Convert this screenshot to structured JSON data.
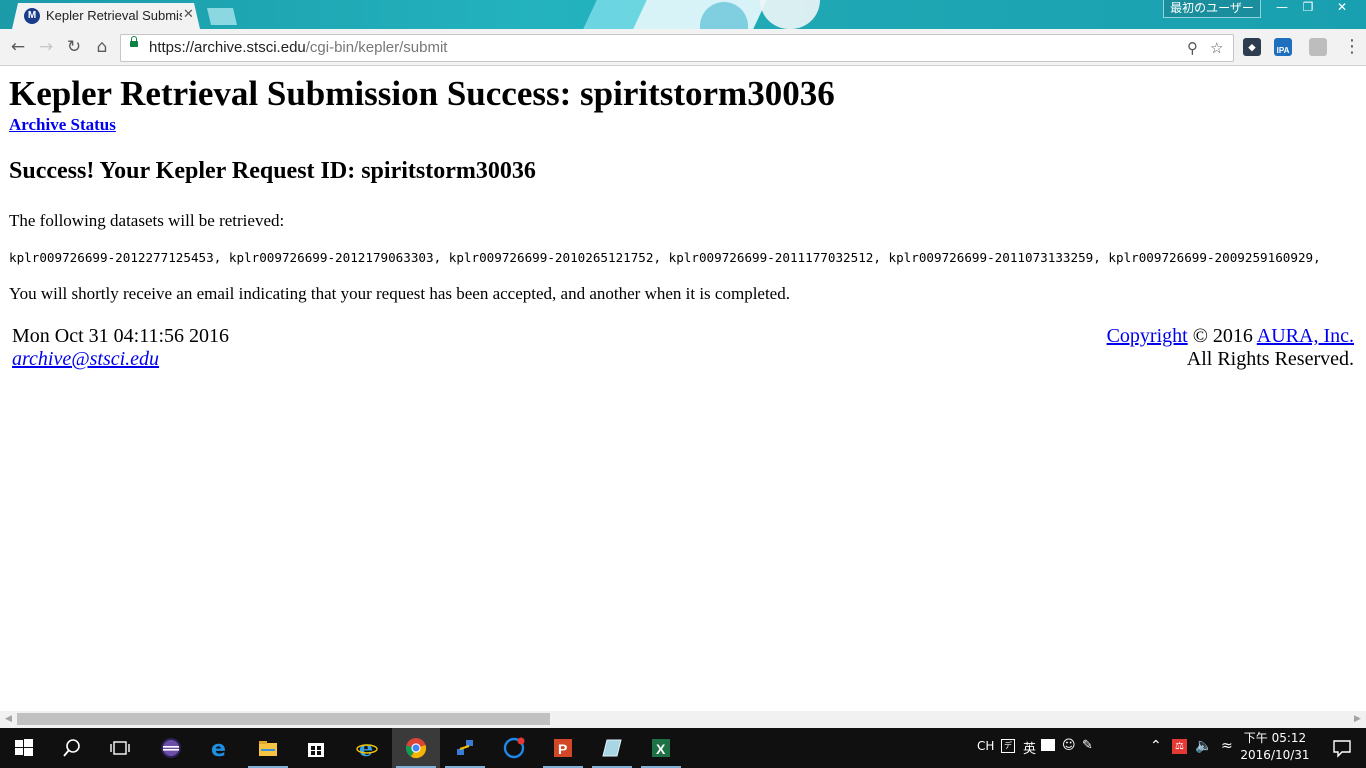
{
  "browser": {
    "tab_title": "Kepler Retrieval Submis",
    "favicon_letter": "M",
    "tab_close": "✕",
    "profile_name": "最初のユーザー",
    "url_scheme": "https://",
    "url_host": "archive.stsci.edu",
    "url_path": "/cgi-bin/kepler/submit",
    "icons": {
      "back": "arrow-left-icon",
      "forward": "arrow-right-icon",
      "reload": "reload-icon",
      "home": "home-icon",
      "secure": "lock-icon",
      "zoom": "zoom-icon",
      "bookmark": "star-icon",
      "menu": "menu-icon"
    },
    "extension_label_ipa": "IPA"
  },
  "page": {
    "title": "Kepler Retrieval Submission Success: spiritstorm30036",
    "archive_status_link": "Archive Status",
    "success_heading": "Success! Your Kepler Request ID: spiritstorm30036",
    "datasets_intro": "The following datasets will be retrieved:",
    "datasets": "kplr009726699-2012277125453, kplr009726699-2012179063303, kplr009726699-2010265121752, kplr009726699-2011177032512, kplr009726699-2011073133259, kplr009726699-2009259160929,",
    "notice": "You will shortly receive an email indicating that your request has been accepted, and another when it is completed.",
    "footer": {
      "timestamp": "Mon Oct 31 04:11:56 2016",
      "email": "archive@stsci.edu",
      "copyright_link": "Copyright",
      "copyright_year": " © 2016 ",
      "aura_link": "AURA, Inc.",
      "rights": "All Rights Reserved."
    }
  },
  "taskbar": {
    "apps": [
      "start-icon",
      "search-icon",
      "task-view-icon",
      "eclipse-icon",
      "edge-icon",
      "file-explorer-icon",
      "store-icon",
      "internet-explorer-icon",
      "chrome-icon",
      "network-app-icon",
      "browser-c-icon",
      "powerpoint-icon",
      "notes-icon",
      "excel-icon"
    ],
    "active_app": "chrome-icon",
    "tray": {
      "lang": "CH",
      "ime": "英",
      "time": "下午 05:12",
      "date": "2016/10/31"
    }
  },
  "colors": {
    "link": "#0000ee",
    "title_bar": "#1fa7b4",
    "taskbar": "#101010"
  }
}
